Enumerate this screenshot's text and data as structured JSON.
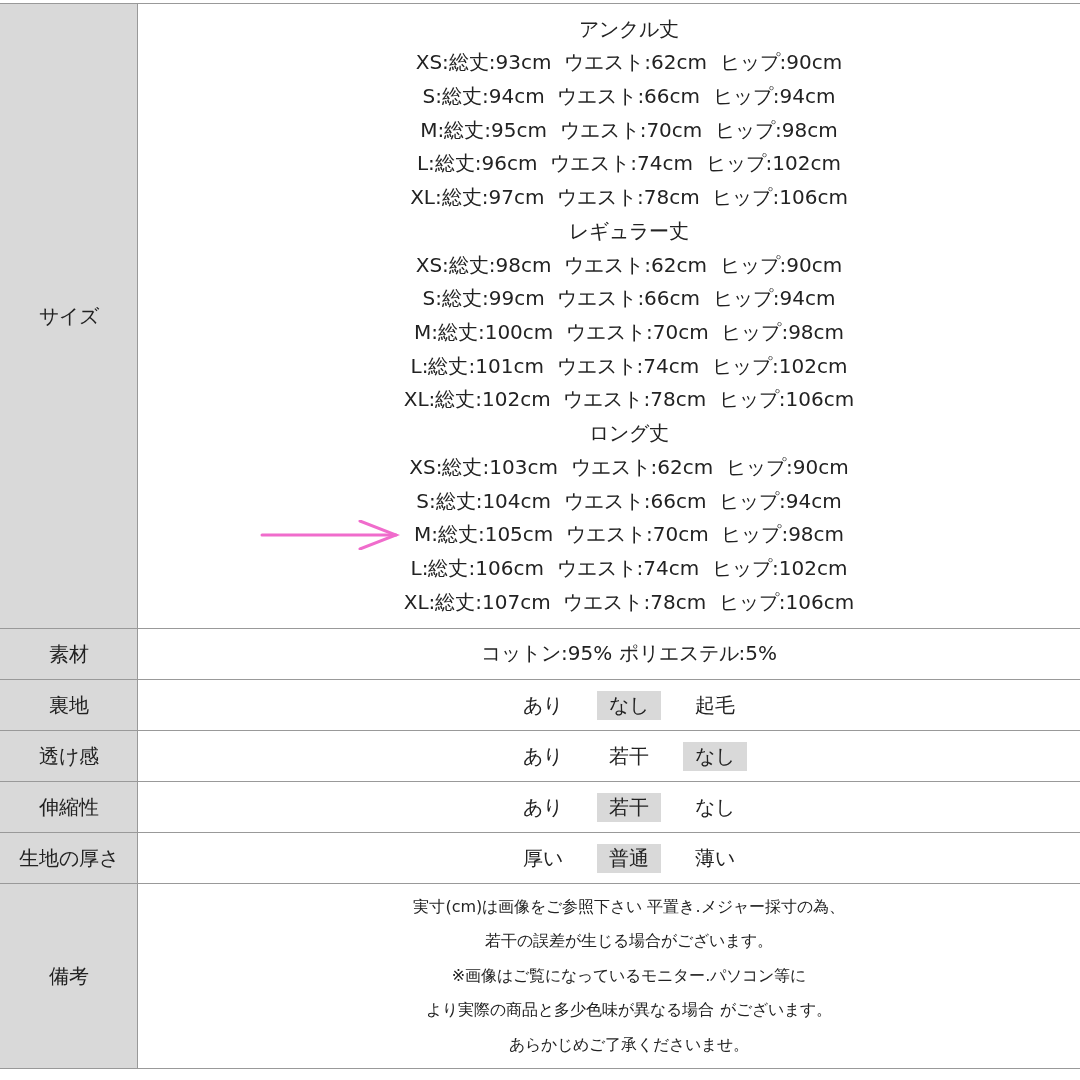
{
  "rows": [
    {
      "kind": "size",
      "label": "サイズ",
      "groups": [
        {
          "heading": "アンクル丈",
          "lines": [
            {
              "text": "XS:総丈:93cm  ウエスト:62cm  ヒップ:90cm",
              "marked": false
            },
            {
              "text": "S:総丈:94cm  ウエスト:66cm  ヒップ:94cm",
              "marked": false
            },
            {
              "text": "M:総丈:95cm  ウエスト:70cm  ヒップ:98cm",
              "marked": false
            },
            {
              "text": "L:総丈:96cm  ウエスト:74cm  ヒップ:102cm",
              "marked": false
            },
            {
              "text": "XL:総丈:97cm  ウエスト:78cm  ヒップ:106cm",
              "marked": false
            }
          ]
        },
        {
          "heading": "レギュラー丈",
          "lines": [
            {
              "text": "XS:総丈:98cm  ウエスト:62cm  ヒップ:90cm",
              "marked": false
            },
            {
              "text": "S:総丈:99cm  ウエスト:66cm  ヒップ:94cm",
              "marked": false
            },
            {
              "text": "M:総丈:100cm  ウエスト:70cm  ヒップ:98cm",
              "marked": false
            },
            {
              "text": "L:総丈:101cm  ウエスト:74cm  ヒップ:102cm",
              "marked": false
            },
            {
              "text": "XL:総丈:102cm  ウエスト:78cm  ヒップ:106cm",
              "marked": false
            }
          ]
        },
        {
          "heading": "ロング丈",
          "lines": [
            {
              "text": "XS:総丈:103cm  ウエスト:62cm  ヒップ:90cm",
              "marked": false
            },
            {
              "text": "S:総丈:104cm  ウエスト:66cm  ヒップ:94cm",
              "marked": false
            },
            {
              "text": "M:総丈:105cm  ウエスト:70cm  ヒップ:98cm",
              "marked": true
            },
            {
              "text": "L:総丈:106cm  ウエスト:74cm  ヒップ:102cm",
              "marked": false
            },
            {
              "text": "XL:総丈:107cm  ウエスト:78cm  ヒップ:106cm",
              "marked": false
            }
          ]
        }
      ]
    },
    {
      "kind": "text",
      "label": "素材",
      "value": "コットン:95% ポリエステル:5%"
    },
    {
      "kind": "options",
      "label": "裏地",
      "options": [
        {
          "label": "あり",
          "selected": false
        },
        {
          "label": "なし",
          "selected": true
        },
        {
          "label": "起毛",
          "selected": false
        }
      ]
    },
    {
      "kind": "options",
      "label": "透け感",
      "options": [
        {
          "label": "あり",
          "selected": false
        },
        {
          "label": "若干",
          "selected": false
        },
        {
          "label": "なし",
          "selected": true
        }
      ]
    },
    {
      "kind": "options",
      "label": "伸縮性",
      "options": [
        {
          "label": "あり",
          "selected": false
        },
        {
          "label": "若干",
          "selected": true
        },
        {
          "label": "なし",
          "selected": false
        }
      ]
    },
    {
      "kind": "options",
      "label": "生地の厚さ",
      "options": [
        {
          "label": "厚い",
          "selected": false
        },
        {
          "label": "普通",
          "selected": true
        },
        {
          "label": "薄い",
          "selected": false
        }
      ]
    },
    {
      "kind": "notes",
      "label": "備考",
      "lines": [
        "実寸(cm)は画像をご参照下さい 平置き.メジャー採寸の為、",
        "若干の誤差が生じる場合がございます。",
        "※画像はご覧になっているモニター.パソコン等に",
        "より実際の商品と多少色味が異なる場合 がございます。",
        "あらかじめご了承くださいませ。"
      ]
    }
  ]
}
